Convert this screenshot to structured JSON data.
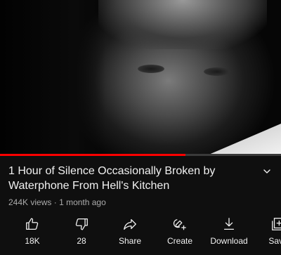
{
  "video": {
    "progress": 0.66
  },
  "title": "1 Hour of Silence Occasionally Broken by Waterphone From Hell's Kitchen",
  "meta": {
    "views": "244K views",
    "separator": "·",
    "age": "1 month ago"
  },
  "actions": [
    {
      "icon": "thumbs-up-icon",
      "label": "18K"
    },
    {
      "icon": "thumbs-down-icon",
      "label": "28"
    },
    {
      "icon": "share-icon",
      "label": "Share"
    },
    {
      "icon": "create-icon",
      "label": "Create"
    },
    {
      "icon": "download-icon",
      "label": "Download"
    },
    {
      "icon": "save-icon",
      "label": "Save"
    }
  ],
  "colors": {
    "background": "#0f0f0f",
    "progress": "#ff0000",
    "text": "#f1f1f1",
    "secondary_text": "#aaaaaa"
  }
}
